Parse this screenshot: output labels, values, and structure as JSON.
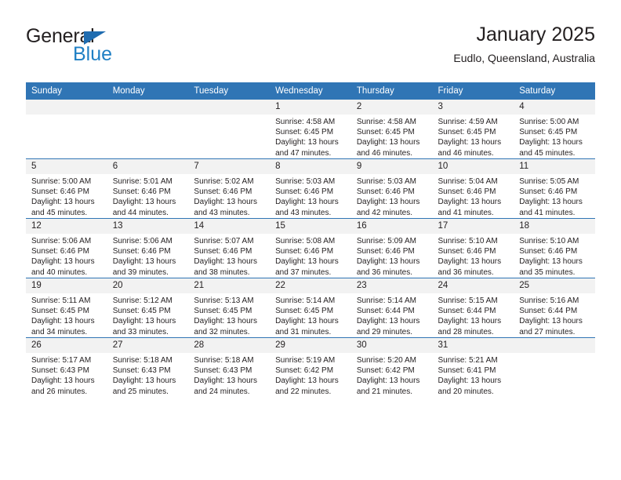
{
  "brand": {
    "name_top": "General",
    "name_bottom": "Blue",
    "triangle_color": "#1f6cb0",
    "blue_color": "#1f7fc4"
  },
  "header": {
    "title": "January 2025",
    "location": "Eudlo, Queensland, Australia"
  },
  "theme": {
    "header_band": "#3075b5",
    "daynum_band": "#f2f2f2",
    "text": "#231f20"
  },
  "weekday_headers": [
    "Sunday",
    "Monday",
    "Tuesday",
    "Wednesday",
    "Thursday",
    "Friday",
    "Saturday"
  ],
  "weeks": [
    [
      {
        "day": "",
        "empty": true,
        "sunrise": "",
        "sunset": "",
        "daylight_1": "",
        "daylight_2": ""
      },
      {
        "day": "",
        "empty": true,
        "sunrise": "",
        "sunset": "",
        "daylight_1": "",
        "daylight_2": ""
      },
      {
        "day": "",
        "empty": true,
        "sunrise": "",
        "sunset": "",
        "daylight_1": "",
        "daylight_2": ""
      },
      {
        "day": "1",
        "sunrise": "Sunrise: 4:58 AM",
        "sunset": "Sunset: 6:45 PM",
        "daylight_1": "Daylight: 13 hours",
        "daylight_2": "and 47 minutes."
      },
      {
        "day": "2",
        "sunrise": "Sunrise: 4:58 AM",
        "sunset": "Sunset: 6:45 PM",
        "daylight_1": "Daylight: 13 hours",
        "daylight_2": "and 46 minutes."
      },
      {
        "day": "3",
        "sunrise": "Sunrise: 4:59 AM",
        "sunset": "Sunset: 6:45 PM",
        "daylight_1": "Daylight: 13 hours",
        "daylight_2": "and 46 minutes."
      },
      {
        "day": "4",
        "sunrise": "Sunrise: 5:00 AM",
        "sunset": "Sunset: 6:45 PM",
        "daylight_1": "Daylight: 13 hours",
        "daylight_2": "and 45 minutes."
      }
    ],
    [
      {
        "day": "5",
        "sunrise": "Sunrise: 5:00 AM",
        "sunset": "Sunset: 6:46 PM",
        "daylight_1": "Daylight: 13 hours",
        "daylight_2": "and 45 minutes."
      },
      {
        "day": "6",
        "sunrise": "Sunrise: 5:01 AM",
        "sunset": "Sunset: 6:46 PM",
        "daylight_1": "Daylight: 13 hours",
        "daylight_2": "and 44 minutes."
      },
      {
        "day": "7",
        "sunrise": "Sunrise: 5:02 AM",
        "sunset": "Sunset: 6:46 PM",
        "daylight_1": "Daylight: 13 hours",
        "daylight_2": "and 43 minutes."
      },
      {
        "day": "8",
        "sunrise": "Sunrise: 5:03 AM",
        "sunset": "Sunset: 6:46 PM",
        "daylight_1": "Daylight: 13 hours",
        "daylight_2": "and 43 minutes."
      },
      {
        "day": "9",
        "sunrise": "Sunrise: 5:03 AM",
        "sunset": "Sunset: 6:46 PM",
        "daylight_1": "Daylight: 13 hours",
        "daylight_2": "and 42 minutes."
      },
      {
        "day": "10",
        "sunrise": "Sunrise: 5:04 AM",
        "sunset": "Sunset: 6:46 PM",
        "daylight_1": "Daylight: 13 hours",
        "daylight_2": "and 41 minutes."
      },
      {
        "day": "11",
        "sunrise": "Sunrise: 5:05 AM",
        "sunset": "Sunset: 6:46 PM",
        "daylight_1": "Daylight: 13 hours",
        "daylight_2": "and 41 minutes."
      }
    ],
    [
      {
        "day": "12",
        "sunrise": "Sunrise: 5:06 AM",
        "sunset": "Sunset: 6:46 PM",
        "daylight_1": "Daylight: 13 hours",
        "daylight_2": "and 40 minutes."
      },
      {
        "day": "13",
        "sunrise": "Sunrise: 5:06 AM",
        "sunset": "Sunset: 6:46 PM",
        "daylight_1": "Daylight: 13 hours",
        "daylight_2": "and 39 minutes."
      },
      {
        "day": "14",
        "sunrise": "Sunrise: 5:07 AM",
        "sunset": "Sunset: 6:46 PM",
        "daylight_1": "Daylight: 13 hours",
        "daylight_2": "and 38 minutes."
      },
      {
        "day": "15",
        "sunrise": "Sunrise: 5:08 AM",
        "sunset": "Sunset: 6:46 PM",
        "daylight_1": "Daylight: 13 hours",
        "daylight_2": "and 37 minutes."
      },
      {
        "day": "16",
        "sunrise": "Sunrise: 5:09 AM",
        "sunset": "Sunset: 6:46 PM",
        "daylight_1": "Daylight: 13 hours",
        "daylight_2": "and 36 minutes."
      },
      {
        "day": "17",
        "sunrise": "Sunrise: 5:10 AM",
        "sunset": "Sunset: 6:46 PM",
        "daylight_1": "Daylight: 13 hours",
        "daylight_2": "and 36 minutes."
      },
      {
        "day": "18",
        "sunrise": "Sunrise: 5:10 AM",
        "sunset": "Sunset: 6:46 PM",
        "daylight_1": "Daylight: 13 hours",
        "daylight_2": "and 35 minutes."
      }
    ],
    [
      {
        "day": "19",
        "sunrise": "Sunrise: 5:11 AM",
        "sunset": "Sunset: 6:45 PM",
        "daylight_1": "Daylight: 13 hours",
        "daylight_2": "and 34 minutes."
      },
      {
        "day": "20",
        "sunrise": "Sunrise: 5:12 AM",
        "sunset": "Sunset: 6:45 PM",
        "daylight_1": "Daylight: 13 hours",
        "daylight_2": "and 33 minutes."
      },
      {
        "day": "21",
        "sunrise": "Sunrise: 5:13 AM",
        "sunset": "Sunset: 6:45 PM",
        "daylight_1": "Daylight: 13 hours",
        "daylight_2": "and 32 minutes."
      },
      {
        "day": "22",
        "sunrise": "Sunrise: 5:14 AM",
        "sunset": "Sunset: 6:45 PM",
        "daylight_1": "Daylight: 13 hours",
        "daylight_2": "and 31 minutes."
      },
      {
        "day": "23",
        "sunrise": "Sunrise: 5:14 AM",
        "sunset": "Sunset: 6:44 PM",
        "daylight_1": "Daylight: 13 hours",
        "daylight_2": "and 29 minutes."
      },
      {
        "day": "24",
        "sunrise": "Sunrise: 5:15 AM",
        "sunset": "Sunset: 6:44 PM",
        "daylight_1": "Daylight: 13 hours",
        "daylight_2": "and 28 minutes."
      },
      {
        "day": "25",
        "sunrise": "Sunrise: 5:16 AM",
        "sunset": "Sunset: 6:44 PM",
        "daylight_1": "Daylight: 13 hours",
        "daylight_2": "and 27 minutes."
      }
    ],
    [
      {
        "day": "26",
        "sunrise": "Sunrise: 5:17 AM",
        "sunset": "Sunset: 6:43 PM",
        "daylight_1": "Daylight: 13 hours",
        "daylight_2": "and 26 minutes."
      },
      {
        "day": "27",
        "sunrise": "Sunrise: 5:18 AM",
        "sunset": "Sunset: 6:43 PM",
        "daylight_1": "Daylight: 13 hours",
        "daylight_2": "and 25 minutes."
      },
      {
        "day": "28",
        "sunrise": "Sunrise: 5:18 AM",
        "sunset": "Sunset: 6:43 PM",
        "daylight_1": "Daylight: 13 hours",
        "daylight_2": "and 24 minutes."
      },
      {
        "day": "29",
        "sunrise": "Sunrise: 5:19 AM",
        "sunset": "Sunset: 6:42 PM",
        "daylight_1": "Daylight: 13 hours",
        "daylight_2": "and 22 minutes."
      },
      {
        "day": "30",
        "sunrise": "Sunrise: 5:20 AM",
        "sunset": "Sunset: 6:42 PM",
        "daylight_1": "Daylight: 13 hours",
        "daylight_2": "and 21 minutes."
      },
      {
        "day": "31",
        "sunrise": "Sunrise: 5:21 AM",
        "sunset": "Sunset: 6:41 PM",
        "daylight_1": "Daylight: 13 hours",
        "daylight_2": "and 20 minutes."
      },
      {
        "day": "",
        "empty": true,
        "sunrise": "",
        "sunset": "",
        "daylight_1": "",
        "daylight_2": ""
      }
    ]
  ]
}
